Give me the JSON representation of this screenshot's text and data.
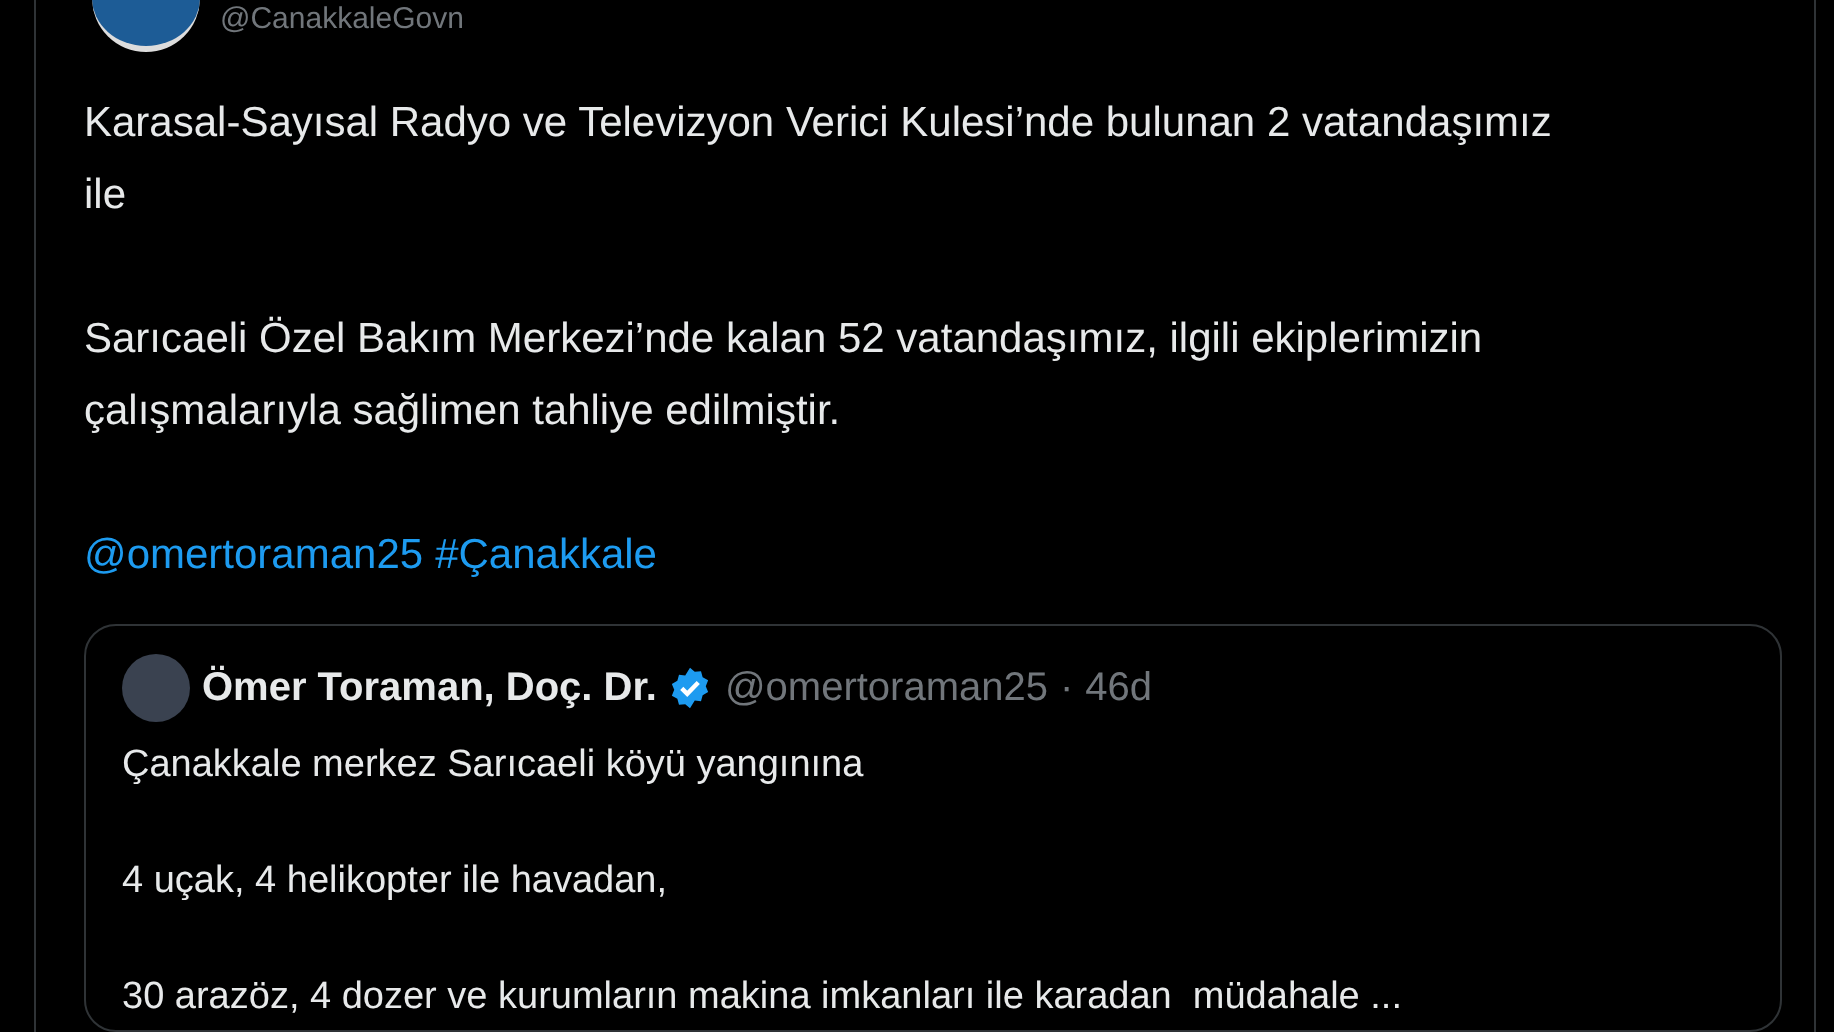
{
  "author": {
    "handle": "@CanakkaleGovn"
  },
  "tweet": {
    "paragraphs": [
      "Karasal-Sayısal Radyo ve Televizyon Verici Kulesi’nde bulunan 2 vatandaşımız ile",
      "Sarıcaeli Özel Bakım Merkezi’nde kalan 52 vatandaşımız, ilgili ekiplerimizin çalışmalarıyla sağlimen tahliye edilmiştir."
    ],
    "links": [
      "@omertoraman25",
      "#Çanakkale"
    ]
  },
  "quote": {
    "name": "Ömer Toraman, Doç. Dr.",
    "verified": true,
    "handle": "@omertoraman25",
    "separator": "·",
    "time": "46d",
    "paragraphs": [
      "Çanakkale merkez Sarıcaeli köyü yangınına",
      "4 uçak, 4 helikopter ile havadan,",
      "30 arazöz, 4 dozer ve kurumların makina imkanları ile karadan  müdahale ..."
    ]
  }
}
